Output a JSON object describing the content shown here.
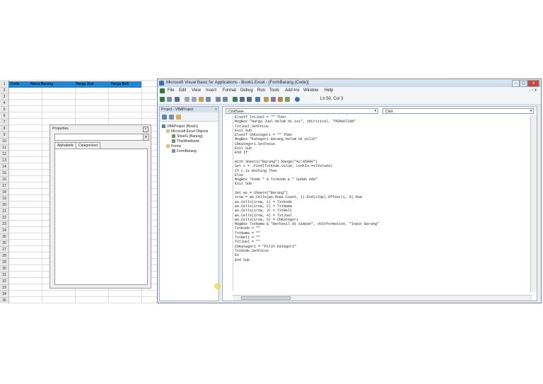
{
  "excel": {
    "row_numbers": [
      "1",
      "2",
      "3",
      "4",
      "5",
      "6",
      "7",
      "8",
      "9",
      "10",
      "11",
      "12",
      "13",
      "14",
      "15",
      "16",
      "17",
      "18",
      "19",
      "20",
      "21",
      "22",
      "23",
      "24",
      "25",
      "26",
      "27",
      "28",
      "29",
      "30",
      "31",
      "32",
      "33",
      "34",
      "35"
    ],
    "headers": [
      "Kode",
      "Nama Barang",
      "Harga Jual",
      "Harga Beli"
    ]
  },
  "properties_panel": {
    "title": "Properties",
    "tabs": [
      "Alphabetic",
      "Categorized"
    ]
  },
  "vbe": {
    "title": "Microsoft Visual Basic for Applications - Book1 Excel - [FormBarang (Code)]",
    "menu": [
      "File",
      "Edit",
      "View",
      "Insert",
      "Format",
      "Debug",
      "Run",
      "Tools",
      "Add-Ins",
      "Window",
      "Help"
    ],
    "cursor_position": "Ln 50, Col 3",
    "project": {
      "title": "Project - VBAProject",
      "tree": [
        "VBAProject (Book1)",
        "Microsoft Excel Objects",
        "Sheet1 (Barang)",
        "ThisWorkbook",
        "Forms",
        "FormBarang"
      ]
    },
    "code": {
      "object_dropdown": "CmdSave",
      "procedure_dropdown": "Click",
      "lines": [
        "ElseIf TxtJual = \"\" Then",
        "MsgBox \"Harga Jual belum di isi\", vbCritical, \"PERHATIAN\"",
        "TxtJual.SetFocus",
        "Exit Sub",
        "ElseIf CbKategori = \"\" Then",
        "MsgBox \"Kategori Barang belum di pilih\"",
        "CbKategori.SetFocus",
        "Exit Sub",
        "End If",
        "",
        "With Sheets(\"Barang\").Range(\"A2:A5000\")",
        "Set c = .Find(TxtKode.Value, LookIn:=xlValues)",
        "If c Is Nothing Then",
        "Else",
        "MsgBox \"Kode \" & TxtKode & \" Sudah Ada\"",
        "Exit Sub",
        "",
        "Set ws = Sheets(\"Barang\")",
        "irow = ws.Cells(ws.Rows.Count, 1).End(xlUp).Offset(1, 0).Row",
        "ws.Cells(irow, 1) = TxtKode",
        "ws.Cells(irow, 2) = TxtNama",
        "ws.Cells(irow, 3) = TxtBeli",
        "ws.Cells(irow, 4) = TxtJual",
        "ws.Cells(irow, 5) = CbKategori",
        "MsgBox TxtNama & \"Berhasil di Simpan\", vbInformation, \"Input Barang\"",
        "TxtKode = \"\"",
        "TxtNama = \"\"",
        "TxtBeli = \"\"",
        "TxtJual = \"\"",
        "CbKategori = \"Pilih Kategori\"",
        "TxtKode.SetFocus",
        "En",
        "End Sub"
      ]
    }
  }
}
